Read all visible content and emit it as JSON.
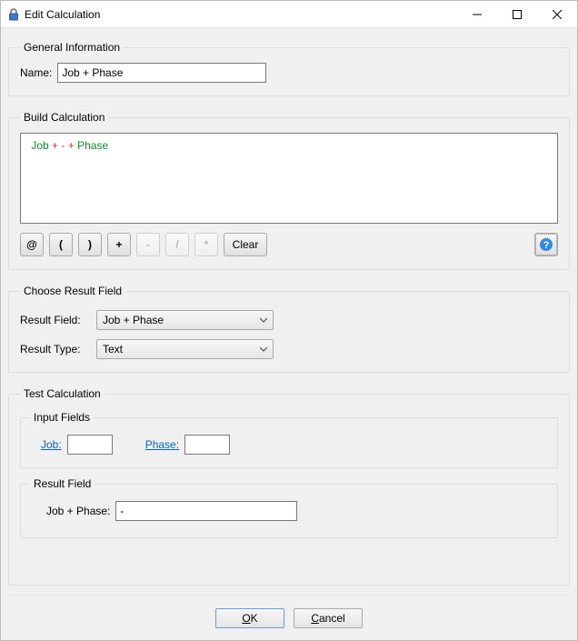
{
  "window": {
    "title": "Edit Calculation"
  },
  "general": {
    "legend": "General Information",
    "name_label": "Name:",
    "name_value": "Job + Phase"
  },
  "build": {
    "legend": "Build Calculation",
    "tokens": {
      "t1": "Job",
      "t2": "+",
      "t3": "-",
      "t4": "+",
      "t5": "Phase"
    },
    "buttons": {
      "at": "@",
      "lparen": "(",
      "rparen": ")",
      "plus": "+",
      "minus": "-",
      "slash": "/",
      "star": "*",
      "clear": "Clear"
    }
  },
  "chooseResult": {
    "legend": "Choose Result Field",
    "field_label": "Result Field:",
    "field_value": "Job + Phase",
    "type_label": "Result Type:",
    "type_value": "Text"
  },
  "test": {
    "legend": "Test Calculation",
    "inputs_legend": "Input Fields",
    "job_label": "Job:",
    "job_value": "",
    "phase_label": "Phase:",
    "phase_value": "",
    "result_legend": "Result Field",
    "result_label": "Job + Phase:",
    "result_value": "-"
  },
  "footer": {
    "ok": "OK",
    "ok_mn": "O",
    "ok_rest": "K",
    "cancel": "Cancel",
    "cancel_mn": "C",
    "cancel_rest": "ancel"
  }
}
